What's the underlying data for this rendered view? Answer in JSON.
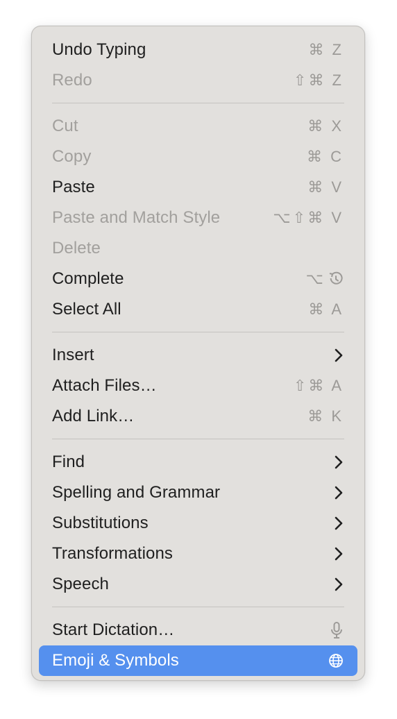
{
  "menu": {
    "groups": [
      [
        {
          "label": "Undo Typing",
          "shortcut": "⌘ Z",
          "disabled": false
        },
        {
          "label": "Redo",
          "shortcut": "⇧⌘ Z",
          "disabled": true
        }
      ],
      [
        {
          "label": "Cut",
          "shortcut": "⌘ X",
          "disabled": true
        },
        {
          "label": "Copy",
          "shortcut": "⌘ C",
          "disabled": true
        },
        {
          "label": "Paste",
          "shortcut": "⌘ V",
          "disabled": false
        },
        {
          "label": "Paste and Match Style",
          "shortcut": "⌥⇧⌘ V",
          "disabled": true
        },
        {
          "label": "Delete",
          "shortcut": "",
          "disabled": true
        },
        {
          "label": "Complete",
          "shortcut": "⌥",
          "icon": "escape-icon",
          "disabled": false
        },
        {
          "label": "Select All",
          "shortcut": "⌘ A",
          "disabled": false
        }
      ],
      [
        {
          "label": "Insert",
          "icon": "chevron-right-icon",
          "disabled": false
        },
        {
          "label": "Attach Files…",
          "shortcut": "⇧⌘ A",
          "disabled": false
        },
        {
          "label": "Add Link…",
          "shortcut": "⌘ K",
          "disabled": false
        }
      ],
      [
        {
          "label": "Find",
          "icon": "chevron-right-icon",
          "disabled": false
        },
        {
          "label": "Spelling and Grammar",
          "icon": "chevron-right-icon",
          "disabled": false
        },
        {
          "label": "Substitutions",
          "icon": "chevron-right-icon",
          "disabled": false
        },
        {
          "label": "Transformations",
          "icon": "chevron-right-icon",
          "disabled": false
        },
        {
          "label": "Speech",
          "icon": "chevron-right-icon",
          "disabled": false
        }
      ],
      [
        {
          "label": "Start Dictation…",
          "icon": "microphone-icon",
          "disabled": false
        },
        {
          "label": "Emoji & Symbols",
          "icon": "globe-icon",
          "disabled": false,
          "selected": true
        }
      ]
    ]
  },
  "colors": {
    "menu_background": "#e2e0dd",
    "highlight": "#5590ee",
    "disabled_text": "#a2a09d",
    "shortcut_text": "#9c9a97"
  }
}
